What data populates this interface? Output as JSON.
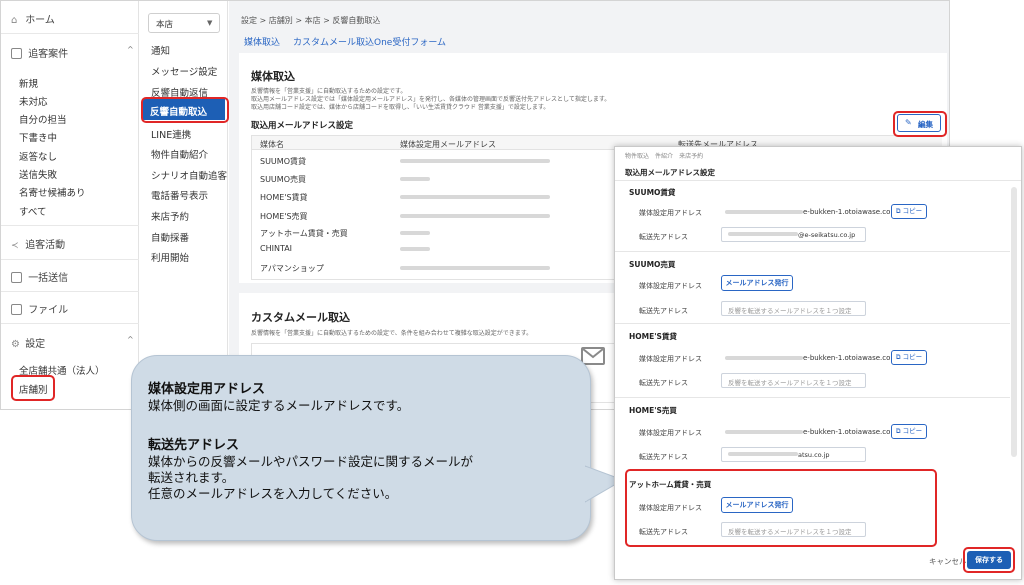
{
  "left_nav": {
    "home": "ホーム",
    "inquiry_section": "追客案件",
    "inquiry_items": [
      "新規",
      "未対応",
      "自分の担当",
      "下書き中",
      "返答なし",
      "送信失敗",
      "名寄せ候補あり",
      "すべて"
    ],
    "activity": "追客活動",
    "bulk_send": "一括送信",
    "file": "ファイル",
    "settings": "設定",
    "settings_items": [
      "全店舗共通（法人）",
      "店舗別"
    ]
  },
  "sub_nav": {
    "store_select": "本店",
    "items": [
      "通知",
      "メッセージ設定",
      "反響自動返信",
      "反響自動取込",
      "LINE連携",
      "物件自動紹介",
      "シナリオ自動追客",
      "電話番号表示",
      "来店予約",
      "自動採番",
      "利用開始"
    ]
  },
  "breadcrumb": [
    "設定",
    "店舗別",
    "本店",
    "反響自動取込"
  ],
  "tabs": [
    "媒体取込",
    "カスタムメール取込",
    "One受付フォーム"
  ],
  "media_section": {
    "title": "媒体取込",
    "desc_lines": [
      "反響情報を「営業支援」に自動取込するための設定です。",
      "取込用メールアドレス設定では「媒体設定用メールアドレス」を発行し、各媒体の管理画面で反響送付先アドレスとして指定します。",
      "取込用店舗コード設定では、媒体から店舗コードを取得し、「いい生活賃貸クラウド 営業支援」で設定します。"
    ],
    "address_heading": "取込用メールアドレス設定",
    "edit_button": "編集",
    "table_headers": [
      "媒体名",
      "媒体設定用メールアドレス",
      "転送先メールアドレス"
    ],
    "rows": [
      "SUUMO賃貸",
      "SUUMO売買",
      "HOME'S賃貸",
      "HOME'S売買",
      "アットホーム賃貸・売買",
      "CHINTAI",
      "アパマンショップ"
    ]
  },
  "custom_section": {
    "title": "カスタムメール取込",
    "desc": "反響情報を「営業支援」に自動取込するための設定で、条件を組み合わせて複雑な取込設定ができます。"
  },
  "modal": {
    "title": "取込用メールアドレス設定",
    "behind_text": [
      "物件取込",
      "件紹介",
      "来店予約"
    ],
    "sections": [
      {
        "name": "SUUMO賃貸",
        "media_value": "e-bukken-1.otoiawase.com",
        "media_action": "コピー",
        "forward_value": "@e-seikatsu.co.jp"
      },
      {
        "name": "SUUMO売買",
        "media_action": "メールアドレス発行",
        "forward_placeholder": "反響を転送するメールアドレスを１つ設定"
      },
      {
        "name": "HOME'S賃貸",
        "media_value": "e-bukken-1.otoiawase.com",
        "media_action": "コピー",
        "forward_placeholder": "反響を転送するメールアドレスを１つ設定"
      },
      {
        "name": "HOME'S売買",
        "media_value": "e-bukken-1.otoiawase.com",
        "media_action": "コピー",
        "forward_value": "atsu.co.jp"
      },
      {
        "name": "アットホーム賃貸・売買",
        "media_action": "メールアドレス発行",
        "forward_placeholder": "反響を転送するメールアドレスを１つ設定"
      }
    ],
    "label_media": "媒体設定用アドレス",
    "label_forward": "転送先アドレス",
    "cancel": "キャンセル",
    "save": "保存する"
  },
  "callout": {
    "title1": "媒体設定用アドレス",
    "text1": "媒体側の画面に設定するメールアドレスです。",
    "title2": "転送先アドレス",
    "text2_lines": [
      "媒体からの反響メールやパスワード設定に関するメールが",
      "転送されます。",
      "任意のメールアドレスを入力してください。"
    ]
  },
  "colors": {
    "accent": "#2a66c4",
    "active_nav": "#1d5fb5",
    "highlight": "#e02626",
    "callout_bg": "#cfdbe6"
  }
}
